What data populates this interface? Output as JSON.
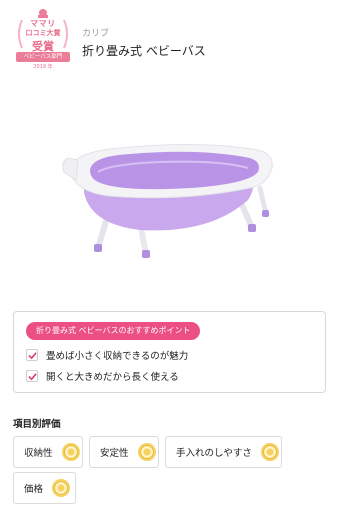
{
  "award": {
    "line1": "ママリ",
    "line2": "口コミ大賞",
    "line3": "受賞",
    "ribbon": "ベビーバス部門",
    "year": "2019 年"
  },
  "brand": "カリブ",
  "product_title": "折り畳み式 ベビーバス",
  "points": {
    "badge": "折り畳み式 ベビーバスのおすすめポイント",
    "items": [
      "畳めば小さく収納できるのが魅力",
      "開くと大きめだから長く使える"
    ]
  },
  "evaluation": {
    "title": "項目別評価",
    "items": [
      {
        "label": "収納性",
        "icon": "medal-icon"
      },
      {
        "label": "安定性",
        "icon": "medal-icon"
      },
      {
        "label": "手入れのしやすさ",
        "icon": "medal-icon"
      },
      {
        "label": "価格",
        "icon": "medal-icon"
      }
    ]
  },
  "colors": {
    "accent_pink": "#ec4f84",
    "award_pink": "#e8718e",
    "medal_gold": "#f2c94c",
    "tub_purple": "#c9a8ee"
  }
}
